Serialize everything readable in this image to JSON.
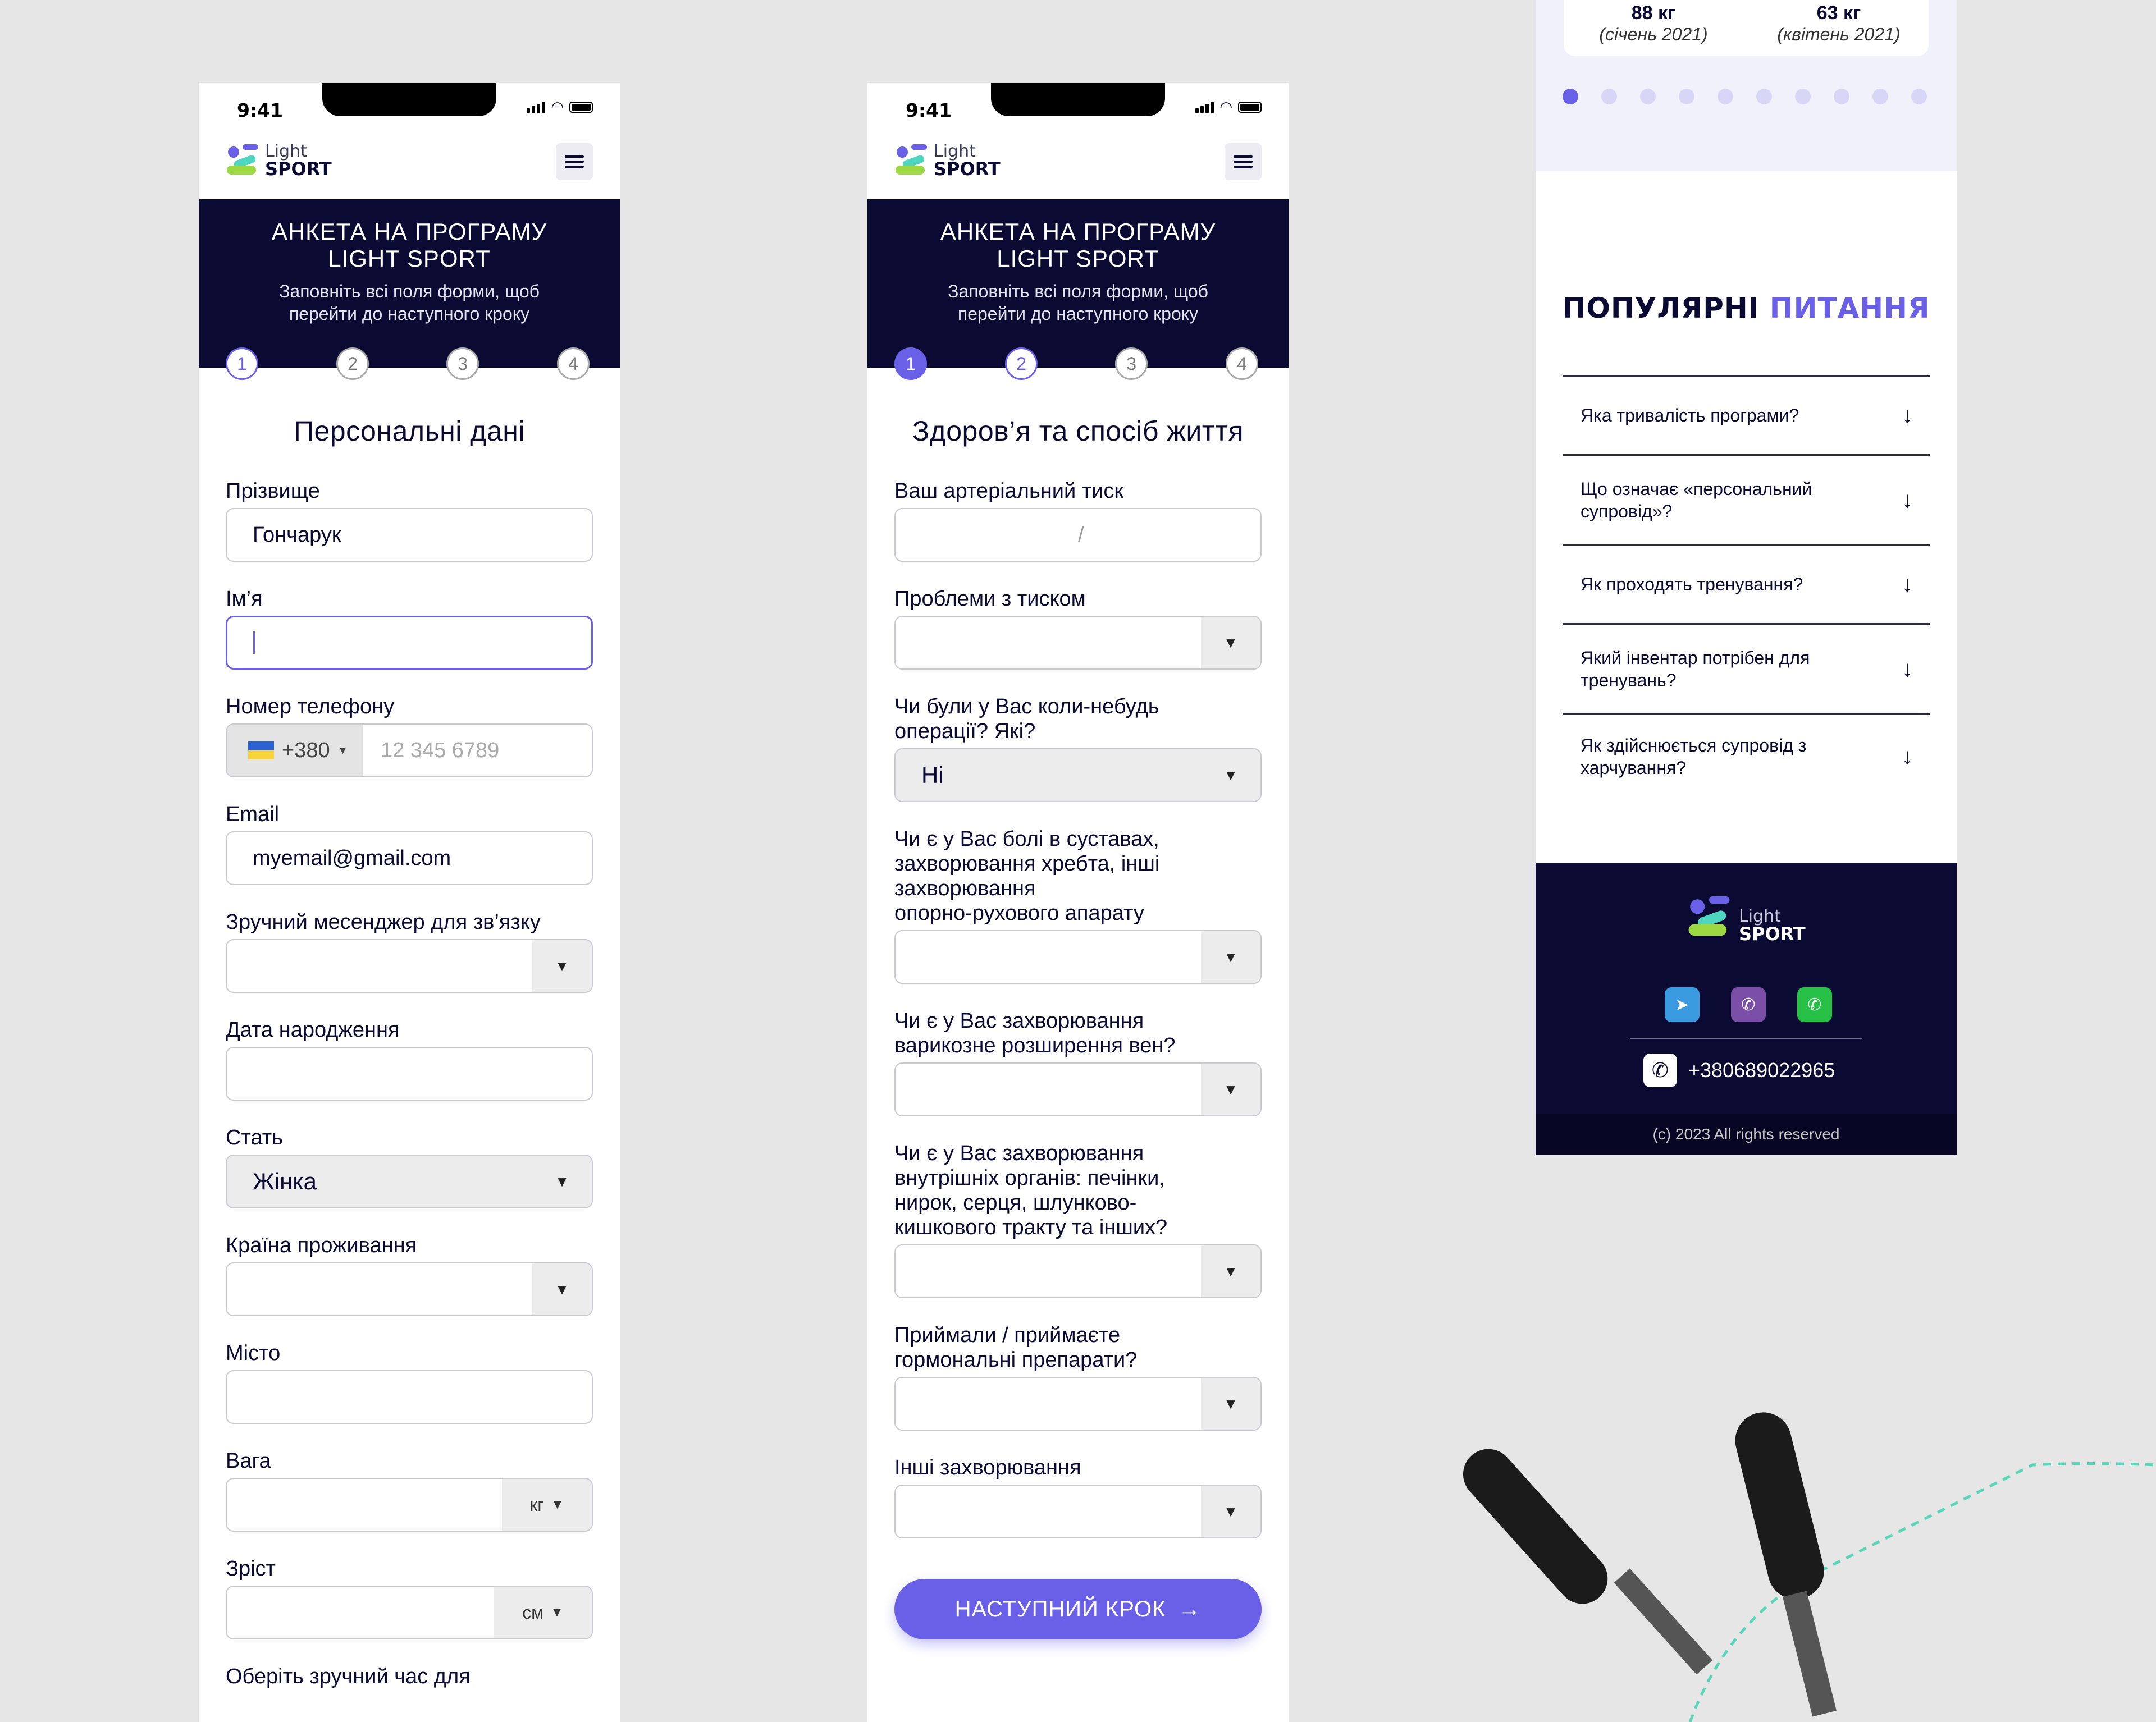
{
  "status": {
    "time": "9:41"
  },
  "logo": {
    "line1": "Light",
    "line2": "SPORT"
  },
  "hero": {
    "title_line1": "АНКЕТА НА ПРОГРАМУ",
    "title_line2": "LIGHT SPORT",
    "subtitle_line1": "Заповніть всі поля форми, щоб",
    "subtitle_line2": "перейти до наступного кроку"
  },
  "steps": [
    "1",
    "2",
    "3",
    "4"
  ],
  "form1": {
    "title": "Персональні дані",
    "surname_label": "Прізвище",
    "surname_value": "Гончарук",
    "name_label": "Ім’я",
    "phone_label": "Номер телефону",
    "phone_code": "+380",
    "phone_placeholder": "12 345 6789",
    "email_label": "Email",
    "email_value": "myemail@gmail.com",
    "messenger_label": "Зручний месенджер для зв’язку",
    "birth_label": "Дата народження",
    "gender_label": "Стать",
    "gender_value": "Жінка",
    "country_label": "Країна проживання",
    "city_label": "Місто",
    "weight_label": "Вага",
    "weight_unit": "кг",
    "height_label": "Зріст",
    "height_unit": "см",
    "time_label": "Оберіть зручний час для"
  },
  "form2": {
    "title": "Здоров’я та спосіб життя",
    "pressure_label": "Ваш артеріальний тиск",
    "pressure_sep": "/",
    "pressure_problems_label": "Проблеми з тиском",
    "operations_label_1": "Чи були у Вас коли-небудь",
    "operations_label_2": "операції? Які?",
    "operations_value": "Ні",
    "joints_label_1": "Чи є у Вас болі в суставах,",
    "joints_label_2": "захворювання хребта, інші",
    "joints_label_3": "захворювання",
    "joints_label_4": "опорно-рухового апарату",
    "veins_label_1": "Чи є у Вас захворювання",
    "veins_label_2": "варикозне розширення вен?",
    "organs_label_1": "Чи є у Вас захворювання",
    "organs_label_2": "внутрішніх органів: печінки,",
    "organs_label_3": "нирок, серця, шлунково-",
    "organs_label_4": "кишкового тракту та інших?",
    "hormones_label_1": "Приймали / приймаєте",
    "hormones_label_2": "гормональні препарати?",
    "other_label": "Інші захворювання",
    "next_button": "НАСТУПНИЙ КРОК"
  },
  "results": {
    "before_weight": "88 кг",
    "before_date": "(січень 2021)",
    "after_weight": "63 кг",
    "after_date": "(квітень 2021)"
  },
  "faq": {
    "title_part1": "ПОПУЛЯРНІ",
    "title_part2": "ПИТАННЯ",
    "items": [
      {
        "line1": "Яка тривалість програми?",
        "line2": ""
      },
      {
        "line1": "Що означає «персональний",
        "line2": "супровід»?"
      },
      {
        "line1": "Як проходять тренування?",
        "line2": ""
      },
      {
        "line1": "Який інвентар потрібен для",
        "line2": "тренувань?"
      },
      {
        "line1": "Як здійснюється супровід з",
        "line2": "харчування?"
      }
    ]
  },
  "footer": {
    "phone": "+380689022965",
    "copyright": "(c) 2023 All rights reserved"
  },
  "colors": {
    "brand_dark": "#0b0a33",
    "accent": "#6a60e8",
    "telegram": "#3a9be0",
    "viber": "#7b4fa8",
    "whatsapp": "#27c046"
  },
  "icons": [
    "menu-icon",
    "chevron-down-icon",
    "arrow-right-icon",
    "arrow-down-icon",
    "telegram-icon",
    "viber-icon",
    "whatsapp-icon",
    "phone-icon",
    "ukraine-flag-icon"
  ]
}
